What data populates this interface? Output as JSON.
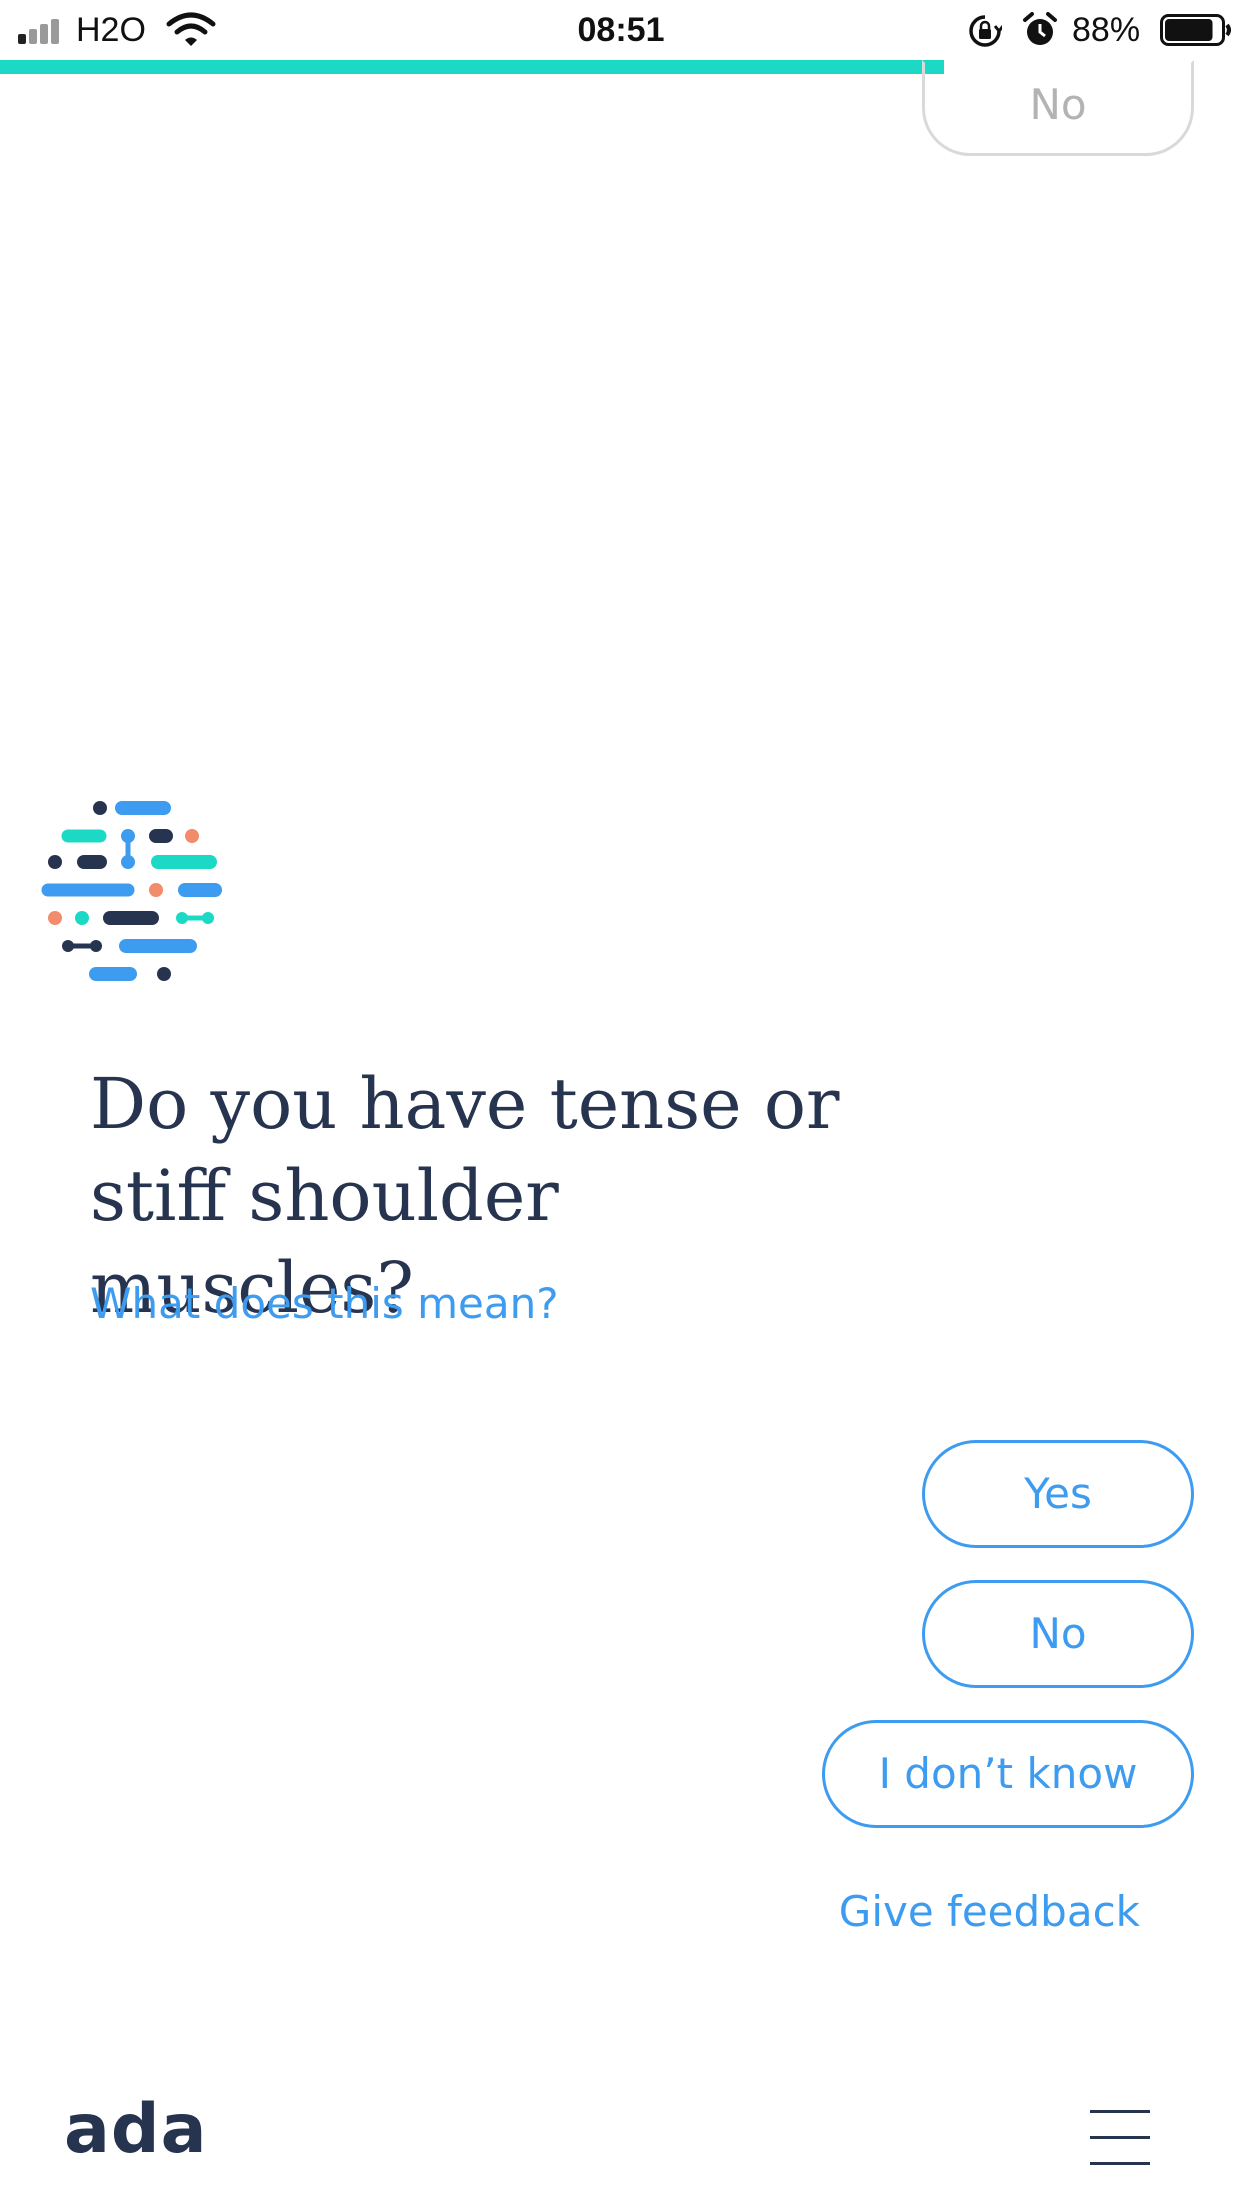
{
  "status_bar": {
    "carrier": "H2O",
    "time": "08:51",
    "battery_percent": "88%",
    "signal_bars_active": 1,
    "battery_level": 0.88
  },
  "progress": {
    "fraction": 0.76,
    "color": "#1cd9c5"
  },
  "previous_answer": {
    "label": "No"
  },
  "question": {
    "text": "Do you have tense or stiff shoulder muscles?",
    "help_link": "What does this mean?"
  },
  "answers": {
    "yes": "Yes",
    "no": "No",
    "dont_know": "I don’t know"
  },
  "feedback_link": "Give feedback",
  "footer": {
    "brand": "ada",
    "menu_icon": "hamburger-menu-icon"
  },
  "colors": {
    "primary_text": "#27344f",
    "accent_blue": "#3d9cf0",
    "accent_teal": "#1cd9c5",
    "accent_coral": "#f28c6a"
  }
}
